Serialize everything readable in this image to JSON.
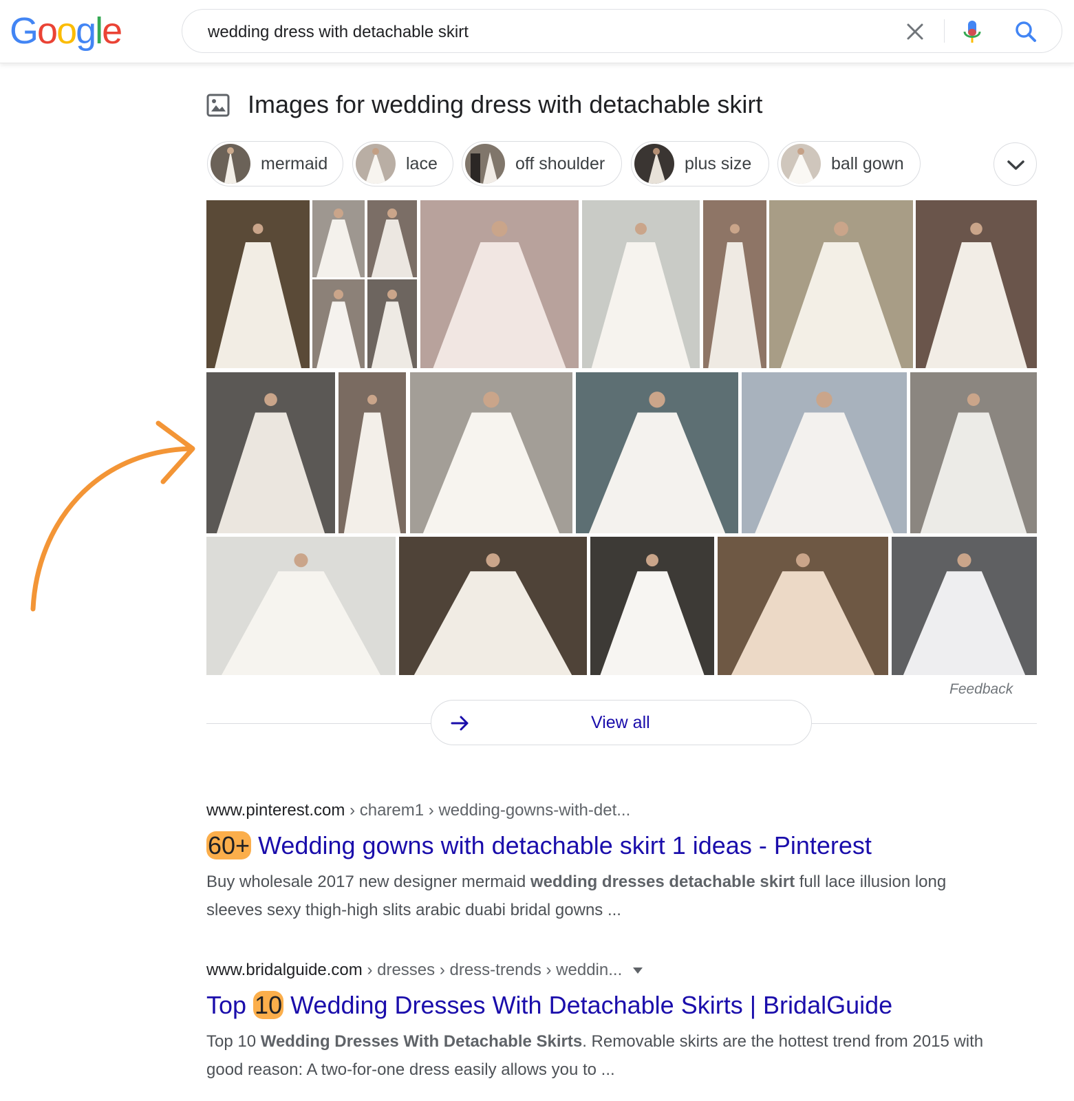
{
  "header": {
    "logo_letters": [
      "G",
      "o",
      "o",
      "g",
      "l",
      "e"
    ],
    "logo_colors": [
      "#4285f4",
      "#ea4335",
      "#fbbc05",
      "#4285f4",
      "#34a853",
      "#ea4335"
    ],
    "search_query": "wedding dress with detachable skirt",
    "icons": [
      "close-icon",
      "mic-icon",
      "search-icon"
    ]
  },
  "images_section": {
    "heading": "Images for wedding dress with detachable skirt",
    "chips": [
      "mermaid",
      "lace",
      "off shoulder",
      "plus size",
      "ball gown"
    ],
    "feedback": "Feedback",
    "view_all": "View all"
  },
  "results": [
    {
      "domain": "www.pinterest.com",
      "path": " › charem1 › wedding-gowns-with-det...",
      "title_highlight": "60+",
      "title_rest": " Wedding gowns with detachable skirt 1 ideas - Pinterest",
      "snippet_pre": "Buy wholesale 2017 new designer mermaid ",
      "snippet_bold": "wedding dresses detachable skirt",
      "snippet_post": " full lace illusion long sleeves sexy thigh-high slits arabic duabi bridal gowns ..."
    },
    {
      "domain": "www.bridalguide.com",
      "path": " › dresses › dress-trends › weddin...",
      "title_pre": "Top ",
      "title_highlight": "10",
      "title_rest": " Wedding Dresses With Detachable Skirts | BridalGuide",
      "snippet_pre": "Top 10 ",
      "snippet_bold": "Wedding Dresses With Detachable Skirts",
      "snippet_post": ". Removable skirts are the hottest trend from 2015 with good reason: A two-for-one dress easily allows you to ..."
    }
  ],
  "colors": {
    "link": "#1a0dab",
    "highlight": "#fbae4b",
    "annotation_arrow": "#f39536"
  }
}
